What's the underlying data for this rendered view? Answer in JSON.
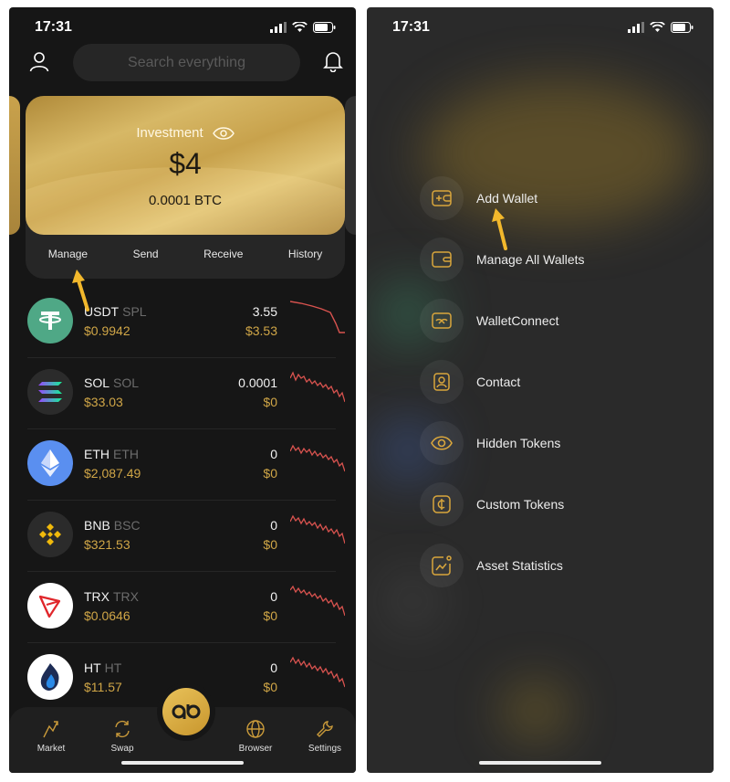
{
  "left": {
    "status": {
      "time": "17:31"
    },
    "search": {
      "placeholder": "Search everything"
    },
    "card": {
      "title": "Investment",
      "amount": "$4",
      "btc": "0.0001 BTC",
      "actions": [
        "Manage",
        "Send",
        "Receive",
        "History"
      ]
    },
    "tokens": [
      {
        "symbol": "USDT",
        "network": "SPL",
        "price": "$0.9942",
        "amount": "3.55",
        "value": "$3.53",
        "icon": "tether-icon"
      },
      {
        "symbol": "SOL",
        "network": "SOL",
        "price": "$33.03",
        "amount": "0.0001",
        "value": "$0",
        "icon": "solana-icon"
      },
      {
        "symbol": "ETH",
        "network": "ETH",
        "price": "$2,087.49",
        "amount": "0",
        "value": "$0",
        "icon": "ethereum-icon"
      },
      {
        "symbol": "BNB",
        "network": "BSC",
        "price": "$321.53",
        "amount": "0",
        "value": "$0",
        "icon": "binance-icon"
      },
      {
        "symbol": "TRX",
        "network": "TRX",
        "price": "$0.0646",
        "amount": "0",
        "value": "$0",
        "icon": "tron-icon"
      },
      {
        "symbol": "HT",
        "network": "HT",
        "price": "$11.57",
        "amount": "0",
        "value": "$0",
        "icon": "huobi-icon"
      }
    ],
    "tabs": {
      "market": "Market",
      "swap": "Swap",
      "browser": "Browser",
      "settings": "Settings"
    }
  },
  "right": {
    "status": {
      "time": "17:31"
    },
    "menu": [
      {
        "label": "Add Wallet",
        "icon": "add-wallet-icon"
      },
      {
        "label": "Manage All Wallets",
        "icon": "wallet-icon"
      },
      {
        "label": "WalletConnect",
        "icon": "walletconnect-icon"
      },
      {
        "label": "Contact",
        "icon": "contact-icon"
      },
      {
        "label": "Hidden Tokens",
        "icon": "eye-icon"
      },
      {
        "label": "Custom Tokens",
        "icon": "coin-icon"
      },
      {
        "label": "Asset Statistics",
        "icon": "statistics-icon"
      }
    ]
  },
  "colors": {
    "accent": "#d0a647",
    "background": "#161616",
    "card_gold": "#c8a24c",
    "spark_red": "#d9534f"
  }
}
